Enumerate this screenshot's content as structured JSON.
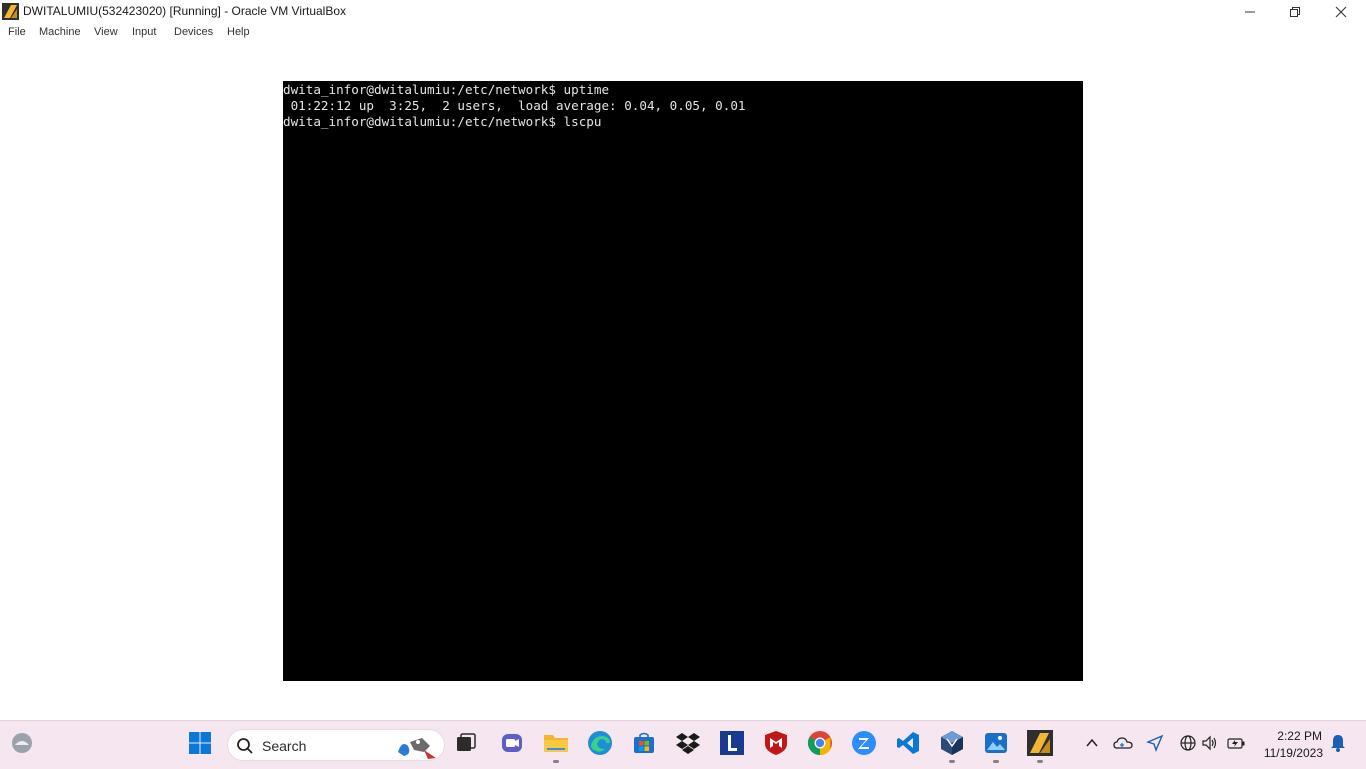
{
  "window": {
    "title": "DWITALUMIU(532423020) [Running] - Oracle VM VirtualBox",
    "app_icon": "virtualbox-icon",
    "controls": [
      "minimize-icon",
      "restore-icon",
      "close-icon"
    ]
  },
  "menu": {
    "items": [
      "File",
      "Machine",
      "View",
      "Input",
      "Devices",
      "Help"
    ]
  },
  "terminal": {
    "lines": [
      "dwita_infor@dwitalumiu:/etc/network$ uptime",
      " 01:22:12 up  3:25,  2 users,  load average: 0.04, 0.05, 0.01",
      "dwita_infor@dwitalumiu:/etc/network$ lscpu"
    ]
  },
  "taskbar": {
    "search_label": "Search",
    "apps": [
      "widgets-icon",
      "start-icon",
      "task-view-icon",
      "teams-chat-icon",
      "file-explorer-icon",
      "edge-icon",
      "store-icon",
      "dropbox-icon",
      "lively-icon",
      "mcafee-icon",
      "chrome-icon",
      "zoom-icon",
      "vscode-icon",
      "virtualbox-icon",
      "photos-icon",
      "virtualbox-vm-icon"
    ],
    "tray": [
      "chevron-up-icon",
      "onedrive-icon",
      "location-icon",
      "globe-icon",
      "volume-icon",
      "battery-icon",
      "notification-bell-icon"
    ],
    "time": "2:22 PM",
    "date": "11/19/2023"
  },
  "colors": {
    "taskbar_bg": "#f5e6ef",
    "console_bg": "#000000",
    "console_text": "#e5e5e5",
    "windows_blue": "#0a78d4"
  }
}
